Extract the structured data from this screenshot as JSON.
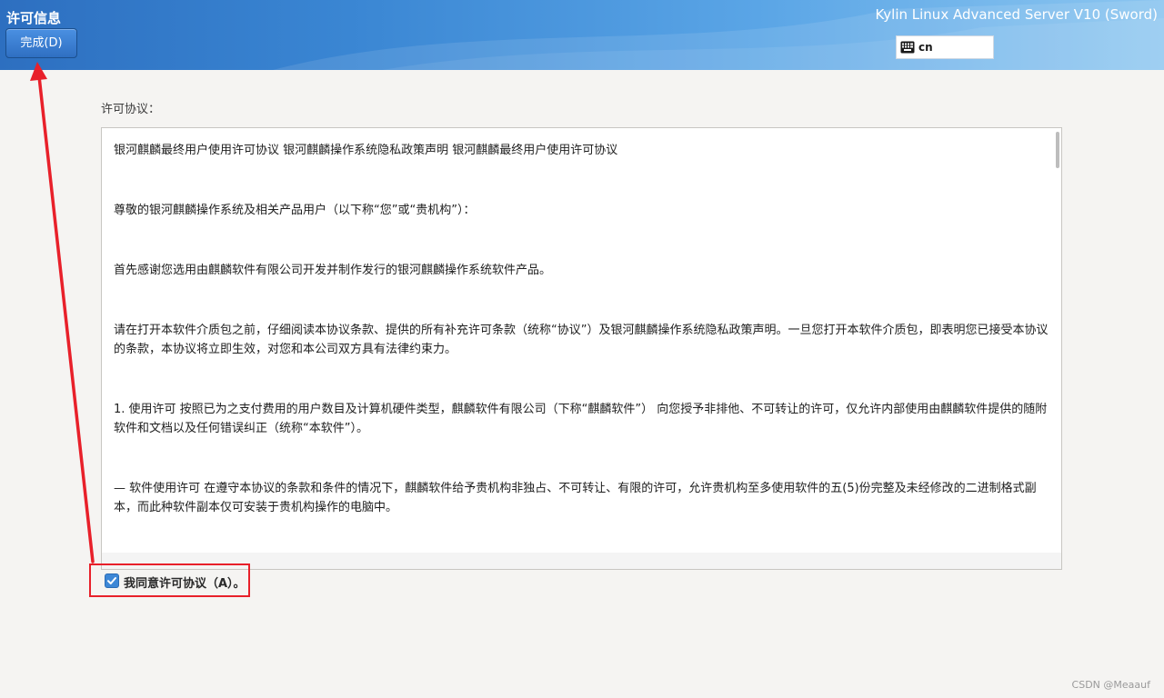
{
  "header": {
    "title": "许可信息",
    "done_button": "完成(D)",
    "product_name": "Kylin Linux Advanced Server V10 (Sword)",
    "keyboard_layout": "cn",
    "keyboard_icon": "keyboard-icon",
    "gradient_colors": [
      "#2d6fc0",
      "#8cc6f0"
    ]
  },
  "license": {
    "label": "许可协议：",
    "paragraphs": [
      "银河麒麟最终用户使用许可协议 银河麒麟操作系统隐私政策声明 银河麒麟最终用户使用许可协议",
      " 尊敬的银河麒麟操作系统及相关产品用户（以下称“您”或“贵机构”）：",
      " 首先感谢您选用由麒麟软件有限公司开发并制作发行的银河麒麟操作系统软件产品。",
      " 请在打开本软件介质包之前，仔细阅读本协议条款、提供的所有补充许可条款（统称“协议”）及银河麒麟操作系统隐私政策声明。一旦您打开本软件介质包，即表明您已接受本协议的条款，本协议将立即生效，对您和本公司双方具有法律约束力。",
      " 1. 使用许可 按照已为之支付费用的用户数目及计算机硬件类型，麒麟软件有限公司（下称“麒麟软件”） 向您授予非排他、不可转让的许可，仅允许内部使用由麒麟软件提供的随附软件和文档以及任何错误纠正（统称“本软件”）。",
      " — 软件使用许可 在遵守本协议的条款和条件的情况下，麒麟软件给予贵机构非独占、不可转让、有限的许可，允许贵机构至多使用软件的五(5)份完整及未经修改的二进制格式副本，而此种软件副本仅可安装于贵机构操作的电脑中。"
    ]
  },
  "agree": {
    "checked": true,
    "label": "我同意许可协议（A）。",
    "check_icon": "checkmark-icon",
    "accent_color": "#3d87d6"
  },
  "annotation": {
    "color": "#e8202a"
  },
  "watermark": "CSDN @Meaauf"
}
